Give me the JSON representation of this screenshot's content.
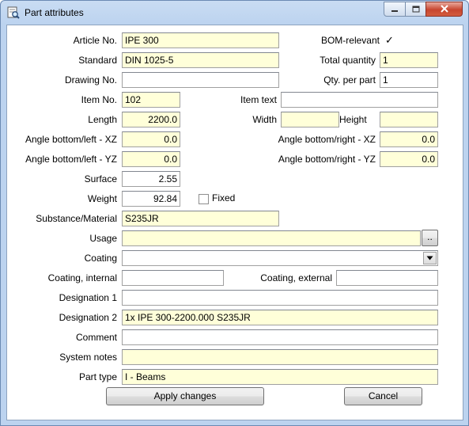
{
  "window": {
    "title": "Part attributes",
    "icon": "part-attributes-icon"
  },
  "fields": {
    "article_no": {
      "label": "Article No.",
      "value": "IPE 300"
    },
    "bom_relevant": {
      "label": "BOM-relevant",
      "checked": true,
      "mark": "✓"
    },
    "standard": {
      "label": "Standard",
      "value": "DIN 1025-5"
    },
    "total_quantity": {
      "label": "Total quantity",
      "value": "1"
    },
    "drawing_no": {
      "label": "Drawing No.",
      "value": ""
    },
    "qty_per_part": {
      "label": "Qty. per part",
      "value": "1"
    },
    "item_no": {
      "label": "Item No.",
      "value": "102"
    },
    "item_text": {
      "label": "Item text",
      "value": ""
    },
    "length": {
      "label": "Length",
      "value": "2200.0"
    },
    "width": {
      "label": "Width",
      "value": ""
    },
    "height": {
      "label": "Height",
      "value": ""
    },
    "angle_bl_xz": {
      "label": "Angle bottom/left - XZ",
      "value": "0.0"
    },
    "angle_br_xz": {
      "label": "Angle bottom/right - XZ",
      "value": "0.0"
    },
    "angle_bl_yz": {
      "label": "Angle bottom/left - YZ",
      "value": "0.0"
    },
    "angle_br_yz": {
      "label": "Angle bottom/right - YZ",
      "value": "0.0"
    },
    "surface": {
      "label": "Surface",
      "value": "2.55"
    },
    "weight": {
      "label": "Weight",
      "value": "92.84"
    },
    "fixed": {
      "label": "Fixed",
      "checked": false
    },
    "material": {
      "label": "Substance/Material",
      "value": "S235JR"
    },
    "usage": {
      "label": "Usage",
      "value": "",
      "browse_label": ".."
    },
    "coating": {
      "label": "Coating",
      "value": ""
    },
    "coating_internal": {
      "label": "Coating, internal",
      "value": ""
    },
    "coating_external": {
      "label": "Coating, external",
      "value": ""
    },
    "designation1": {
      "label": "Designation 1",
      "value": ""
    },
    "designation2": {
      "label": "Designation 2",
      "value": "1x IPE 300-2200.000 S235JR"
    },
    "comment": {
      "label": "Comment",
      "value": ""
    },
    "system_notes": {
      "label": "System notes",
      "value": ""
    },
    "part_type": {
      "label": "Part type",
      "value": "I - Beams"
    }
  },
  "buttons": {
    "apply": "Apply changes",
    "cancel": "Cancel"
  },
  "colors": {
    "readonly_field": "#ffffd9",
    "window_frame": "#bcd3ef",
    "close_button": "#c7462f"
  }
}
